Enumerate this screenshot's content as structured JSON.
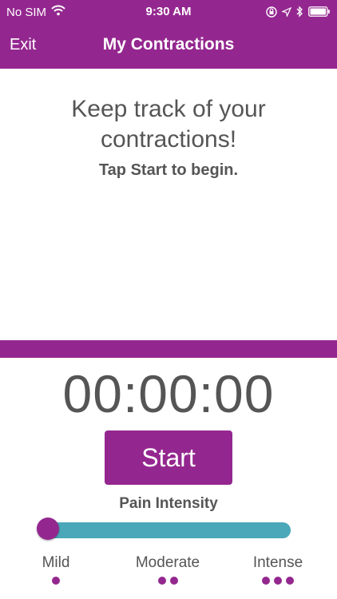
{
  "status_bar": {
    "carrier": "No SIM",
    "time": "9:30 AM",
    "icons": [
      "wifi-icon",
      "orientation-lock-icon",
      "location-icon",
      "bluetooth-icon",
      "battery-icon"
    ]
  },
  "nav": {
    "exit_label": "Exit",
    "title": "My Contractions"
  },
  "intro": {
    "heading": "Keep track of your contractions!",
    "subtext": "Tap Start to begin."
  },
  "timer": {
    "display": "00:00:00"
  },
  "start_button": {
    "label": "Start"
  },
  "pain_intensity": {
    "label": "Pain Intensity",
    "value_fraction": 0.0,
    "levels": [
      {
        "label": "Mild",
        "dots": 1
      },
      {
        "label": "Moderate",
        "dots": 2
      },
      {
        "label": "Intense",
        "dots": 3
      }
    ]
  },
  "colors": {
    "brand_purple": "#94278f",
    "slider_teal": "#4aa8b9",
    "text_gray": "#555555"
  }
}
